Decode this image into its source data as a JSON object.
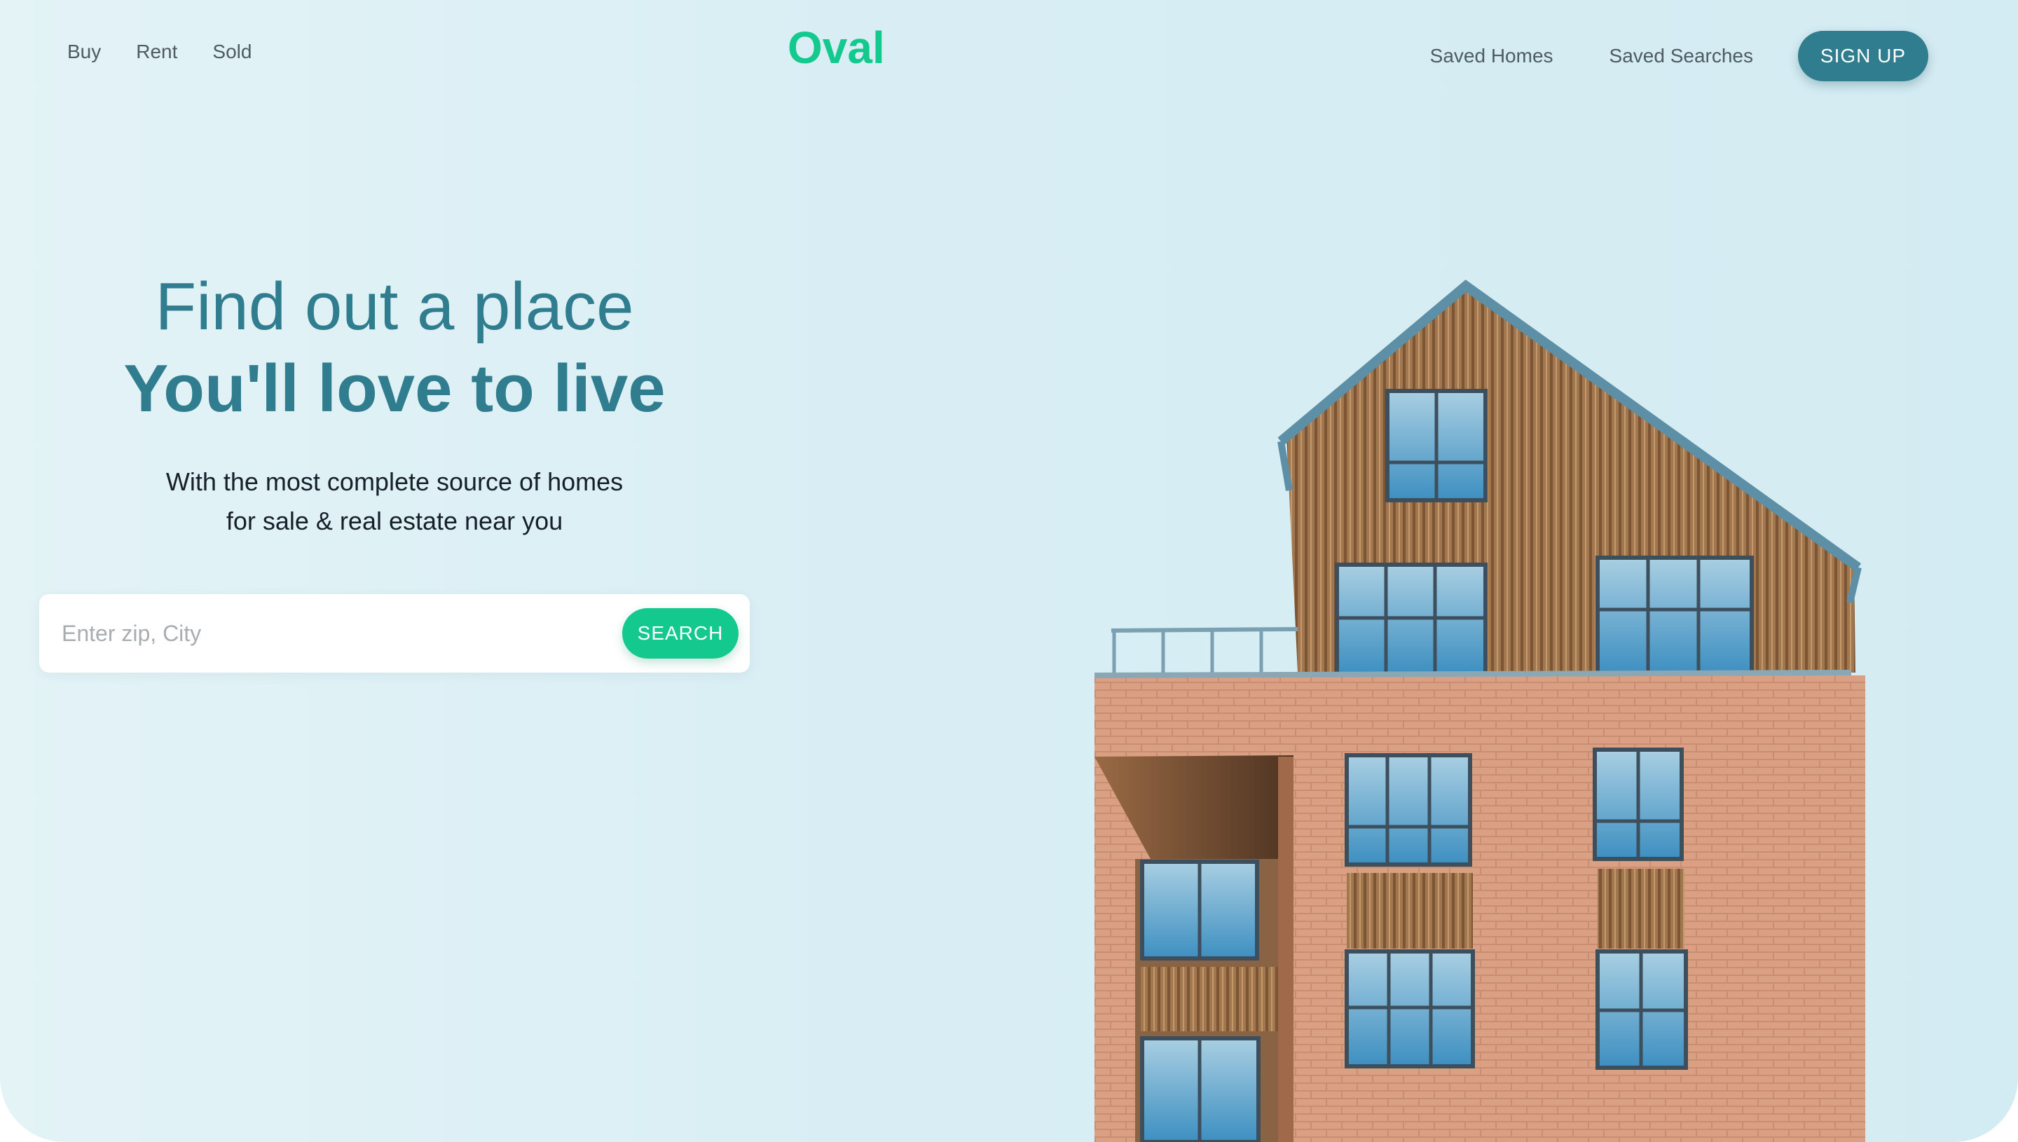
{
  "nav": {
    "left_links": [
      "Buy",
      "Rent",
      "Sold"
    ],
    "right_links": [
      "Saved Homes",
      "Saved Searches"
    ],
    "signup_label": "SIGN UP"
  },
  "logo": {
    "text": "Oval",
    "color": "#14c98e"
  },
  "hero": {
    "line1": "Find out a place",
    "line2": "You'll love to live",
    "subtitle_line1": "With the most complete source of homes",
    "subtitle_line2": "for sale & real estate near you"
  },
  "search": {
    "placeholder": "Enter zip, City",
    "value": "",
    "button_label": "SEARCH"
  },
  "colors": {
    "primary": "#2f7d8e",
    "accent": "#14c98e",
    "background": "#d8eef4"
  },
  "image": {
    "subject": "house-illustration"
  }
}
